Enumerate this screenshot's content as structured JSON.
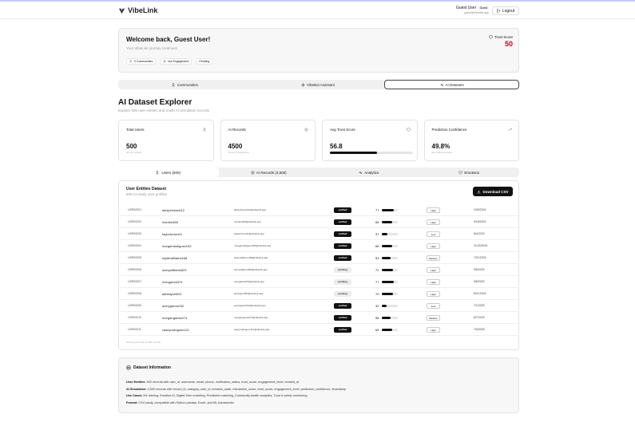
{
  "header": {
    "logo": "VibeLink",
    "user_name": "Guest User",
    "user_badge": "Guest",
    "user_email": "guest@vibelink.app",
    "logout_label": "Logout"
  },
  "welcome": {
    "title": "Welcome back, Guest User!",
    "subtitle": "Your VibeLink journey continues",
    "pills": [
      "0 Communities",
      "low Engagement",
      "Pending"
    ],
    "trust_label": "Trust Score",
    "trust_value": "50"
  },
  "main_tabs": [
    {
      "label": "Communities",
      "icon": "users-icon"
    },
    {
      "label": "VibeBot Assistant",
      "icon": "bot-icon"
    },
    {
      "label": "AI Datasets",
      "icon": "activity-icon"
    }
  ],
  "explorer": {
    "title": "AI Dataset Explorer",
    "subtitle": "Explore 500 user entities and 4,500 AI simulation records",
    "stats": [
      {
        "label": "Total Users",
        "value": "500",
        "sub": "49.4% verified",
        "icon": "users-icon"
      },
      {
        "label": "AI Records",
        "value": "4500",
        "sub": "Across 4 categories",
        "icon": "database-icon"
      },
      {
        "label": "Avg Trust Score",
        "value": "56.8",
        "progress": 0.568,
        "icon": "shield-icon"
      },
      {
        "label": "Prediction Confidence",
        "value": "49.8%",
        "sub": "ML model accuracy",
        "icon": "trend-icon"
      }
    ]
  },
  "sub_tabs": [
    {
      "label": "Users (500)",
      "icon": "users-icon"
    },
    {
      "label": "AI Records (4,500)",
      "icon": "database-icon"
    },
    {
      "label": "Analytics",
      "icon": "activity-icon"
    },
    {
      "label": "Emotions",
      "icon": "heart-icon"
    }
  ],
  "dataset": {
    "title": "User Entities Dataset",
    "subtitle": "500 AI-ready user profiles",
    "download_label": "Download CSV",
    "footer": "Showing first 100 of 500 records",
    "rows": [
      {
        "id": "USR00001",
        "username": "alexjohnson612",
        "email": "alexjohnson612@vibelink.app",
        "verification": "verified",
        "trust": 77,
        "engagement": "High",
        "date": "1/26/2024"
      },
      {
        "id": "USR00002",
        "username": "riverlee465",
        "email": "riverlee465@vibelink.app",
        "verification": "verified",
        "trust": 65,
        "engagement": "High",
        "date": "9/18/2024"
      },
      {
        "id": "USR00003",
        "username": "taylorbrown21",
        "email": "taylorbrown21@vibelink.app",
        "verification": "verified",
        "trust": 37,
        "engagement": "Low",
        "date": "8/4/2024"
      },
      {
        "id": "USR00004",
        "username": "morgandodiguez153",
        "email": "morgandodiguez153@vibelink.app",
        "verification": "verified",
        "trust": 66,
        "engagement": "High",
        "date": "11/15/2024"
      },
      {
        "id": "USR00005",
        "username": "skylerwilliams168",
        "email": "skylerwilliams168@vibelink.app",
        "verification": "verified",
        "trust": 53,
        "engagement": "Medium",
        "date": "7/21/2024"
      },
      {
        "id": "USR00006",
        "username": "averywilliams823",
        "email": "averywilliams823@vibelink.app",
        "verification": "pending",
        "trust": 72,
        "engagement": "High",
        "date": "5/8/2024"
      },
      {
        "id": "USR00007",
        "username": "rivergarcia379",
        "email": "rivergarcia379@vibelink.app",
        "verification": "pending",
        "trust": 77,
        "engagement": "High",
        "date": "5/8/2024"
      },
      {
        "id": "USR00008",
        "username": "alextaylor553",
        "email": "alextaylor553@vibelink.app",
        "verification": "pending",
        "trust": 70,
        "engagement": "High",
        "date": "8/21/2024"
      },
      {
        "id": "USR00009",
        "username": "averygarcia762",
        "email": "averygarcia762@vibelink.app",
        "verification": "verified",
        "trust": 32,
        "engagement": "Low",
        "date": "7/1/2025"
      },
      {
        "id": "USR00010",
        "username": "morgangarcia274",
        "email": "morgangarcia274@vibelink.app",
        "verification": "verified",
        "trust": 56,
        "engagement": "Medium",
        "date": "8/7/2025"
      },
      {
        "id": "USR00011",
        "username": "caseyrodriguez121",
        "email": "caseyrodriguez121@vibelink.app",
        "verification": "verified",
        "trust": 65,
        "engagement": "High",
        "date": "7/6/2025"
      }
    ]
  },
  "info": {
    "title": "Dataset Information",
    "lines": [
      {
        "label": "User Entities:",
        "text": " 500 records with user_id, username, email, phone, verification_status, trust_score, engagement_level, created_at"
      },
      {
        "label": "AI Simulation:",
        "text": " 4,500 records with record_id, category, user_id, emotion_state, interaction_score, trust_score, engagement_level, prediction_confidence, timestamp"
      },
      {
        "label": "Use Cases:",
        "text": " ML training, Emotion AI, Digital Twin modeling, Predictive matching, Community health analytics, Trust & safety monitoring"
      },
      {
        "label": "Format:",
        "text": " CSV-ready, compatible with Python pandas, Excel, and ML frameworks"
      }
    ]
  }
}
